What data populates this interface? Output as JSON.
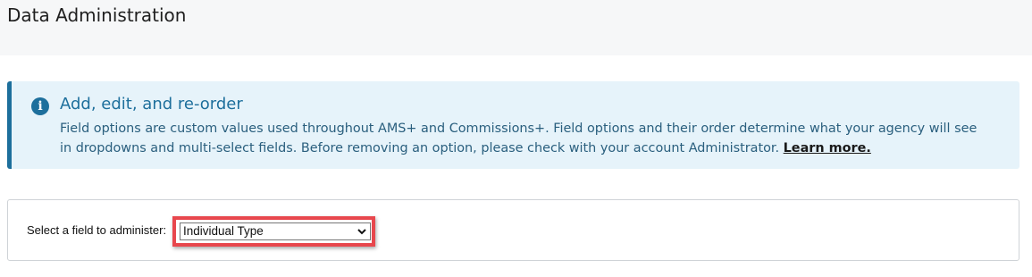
{
  "header": {
    "title": "Data Administration"
  },
  "info_banner": {
    "icon": "info-icon",
    "icon_glyph": "i",
    "heading": "Add, edit, and re-order",
    "body": "Field options are custom values used throughout AMS+ and Commissions+. Field options and their order determine what your agency will see in dropdowns and multi-select fields. Before removing an option, please check with your account Administrator.",
    "link_label": "Learn more.",
    "accent_color": "#1d6f9c",
    "background_color": "#e6f3fa"
  },
  "field_selector": {
    "label": "Select a field to administer:",
    "selected_value": "Individual Type",
    "highlight_color": "#e8474d"
  }
}
